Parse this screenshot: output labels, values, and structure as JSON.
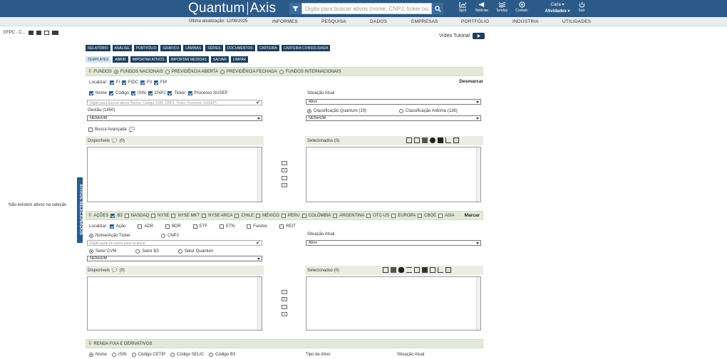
{
  "header": {
    "logo_left": "Quantum",
    "logo_right": "Axis",
    "search_placeholder": "Digite para buscar ativos (nome, CNPJ, ticker ou",
    "icons": [
      {
        "label": "Spot",
        "icon": "chart-icon"
      },
      {
        "label": "Notícias",
        "icon": "megaphone-icon"
      },
      {
        "label": "Tarefas",
        "icon": "tasks-icon"
      },
      {
        "label": "Contato",
        "icon": "contact-icon"
      }
    ],
    "user_name": "Carla",
    "user_activities": "Atividades",
    "logout_label": "Sair"
  },
  "nav": {
    "last_update": "Última atualização: 12/08/2025",
    "items": [
      "INFORMES",
      "PESQUISA",
      "DADOS",
      "EMPRESAS",
      "PORTFÓLIO",
      "INDÚSTRIA",
      "UTILIDADES"
    ]
  },
  "left_panel": {
    "doc_label": "EFPC - C...",
    "empty_message": "Não existem ativos na seleção",
    "side_tab": "ATIVOS SELECIONADOS"
  },
  "main": {
    "video_label": "Vídeo Tutorial",
    "tabs": [
      "RELATÓRIO",
      "ANÁLISE",
      "PORTFÓLIO",
      "GRÁFICO",
      "LÂMINAS",
      "SÉRIES",
      "DOCUMENTOS",
      "CARTEIRA",
      "CARTEIRA CONSOLIDADA"
    ],
    "subtabs": [
      "TEMPLATES",
      "ABRIR",
      "IMPORTAR ATIVOS",
      "IMPORTAR MEDIDAS",
      "SALVAR",
      "LIMPAR"
    ]
  },
  "fundos": {
    "section_label": "FUNDOS",
    "types": [
      "FUNDOS NACIONAIS",
      "PREVIDÊNCIA ABERTA",
      "PREVIDÊNCIA FECHADA",
      "FUNDOS INTERNACIONAIS"
    ],
    "toggle_label": "Desmarcar",
    "localizar_label": "Localizar:",
    "localizar_opts": [
      "FI",
      "FIDC",
      "FII",
      "FIP"
    ],
    "fields": [
      "Nome",
      "Código",
      "ISIN",
      "CNPJ",
      "Ticker",
      "Processo SUSEP"
    ],
    "search_placeholder": "Digite para buscar ativos (Nome, Código, ISIN, CNPJ, Ticker, Processo SUSEP)",
    "situacao_label": "Situação Atual",
    "situacao_value": "Ativo",
    "gestao_label": "Gestão (1450)",
    "gestao_value": "NENHUM",
    "classif_quantum": "Classificação Quantum (19)",
    "classif_anbima": "Classificação Anbima (136)",
    "classif_value": "NENHUM",
    "busca_avancada": "Busca Avançada",
    "disponiveis_label": "Disponíveis",
    "disponiveis_count": "(0)",
    "selecionados_label": "Selecionados (0)"
  },
  "acoes": {
    "section_label": "AÇÕES",
    "markets": [
      "B3",
      "NASDAQ",
      "NYSE",
      "NYSE MKT",
      "NYSE ARCA",
      "CHILE",
      "MÉXICO",
      "PERU",
      "COLÔMBIA",
      "ARGENTINA",
      "OTC-US",
      "EUROPA",
      "CBOE",
      "ASIA"
    ],
    "toggle_label": "Marcar",
    "localizar_label": "Localizar:",
    "localizar_opts": [
      "Ação",
      "ADR",
      "BDR",
      "ETF",
      "ETN",
      "Fundos",
      "REIT"
    ],
    "search_by": [
      "Nome/Ação Ticker",
      "CNPJ"
    ],
    "search_placeholder": "Digite parte do nome para localizar",
    "situacao_label": "Situação Atual",
    "situacao_value": "Ativo",
    "setor_opts": [
      "Setor CVM",
      "Setor B3",
      "Setor Quantum"
    ],
    "setor_value": "NENHUM",
    "disponiveis_label": "Disponíveis",
    "disponiveis_count": "(0)",
    "selecionados_label": "Selecionados (0)"
  },
  "renda_fixa": {
    "section_label": "RENDA FIXA E DERIVATIVOS",
    "search_by": [
      "Nome",
      "ISIN",
      "Código CETIP",
      "Código SELIC",
      "Código B3"
    ],
    "tipo_label": "Tipo de Ativo",
    "situacao_label": "Situação Atual"
  }
}
